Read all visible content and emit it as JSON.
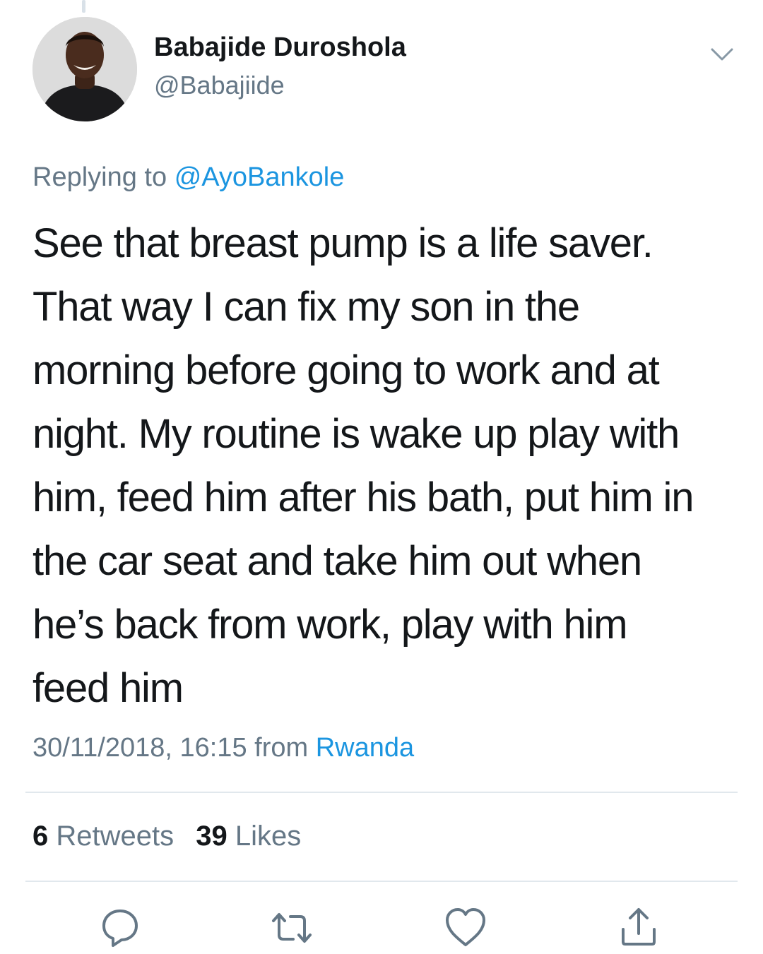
{
  "tweet": {
    "author": {
      "display_name": "Babajide Duroshola",
      "handle": "@Babajiide",
      "avatar_icon": "profile-photo"
    },
    "reply_prefix": "Replying to",
    "reply_to": "@AyoBankole",
    "text_lines": [
      "See that breast pump is a life saver.",
      "That way I can fix my son in the",
      "morning before going to work and at",
      "night. My routine is wake up play with",
      "him, feed him after his bath, put him in",
      "the car seat and take him out when",
      "he’s back from work, play with him",
      "feed him"
    ],
    "timestamp": "30/11/2018, 16:15",
    "from_label": "from",
    "source": "Rwanda"
  },
  "stats": {
    "retweets_count": "6",
    "retweets_label": "Retweets",
    "likes_count": "39",
    "likes_label": "Likes"
  },
  "actions": {
    "icons": [
      "reply-icon",
      "retweet-icon",
      "like-icon",
      "share-icon"
    ]
  },
  "colors": {
    "text": "#14171a",
    "secondary": "#657786",
    "link": "#1b95e0",
    "divider": "#e1e8ed",
    "icon": "#657786"
  }
}
